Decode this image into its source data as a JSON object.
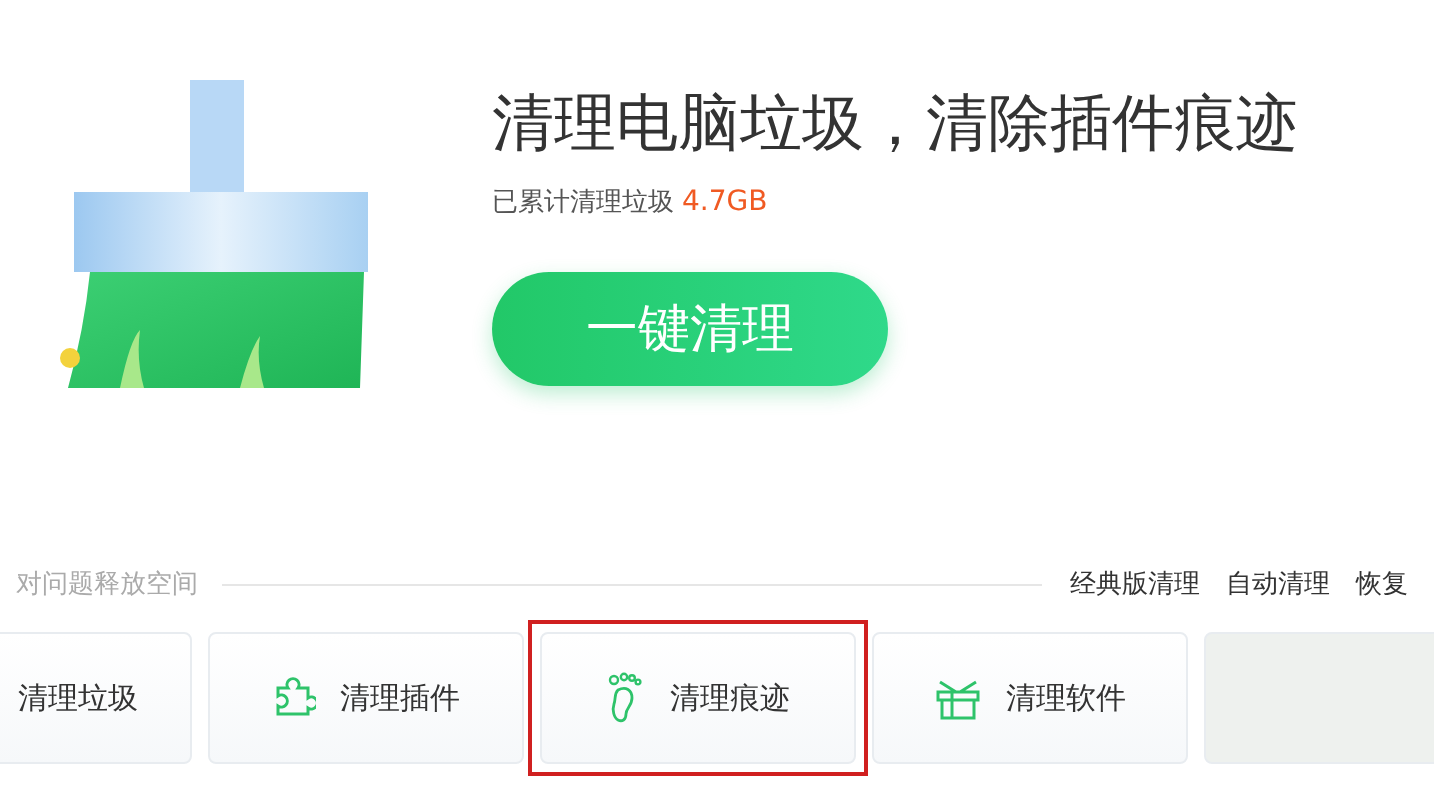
{
  "headline": "清理电脑垃圾，清除插件痕迹",
  "stats": {
    "label": "已累计清理垃圾",
    "value": "4.7GB"
  },
  "clean_button": "一键清理",
  "section": {
    "label": "对问题释放空间",
    "links": [
      "经典版清理",
      "自动清理",
      "恢复"
    ]
  },
  "cards": [
    {
      "kind": "trash",
      "label": "清理垃圾",
      "highlighted": false
    },
    {
      "kind": "plugin",
      "label": "清理插件",
      "highlighted": false
    },
    {
      "kind": "footprint",
      "label": "清理痕迹",
      "highlighted": true
    },
    {
      "kind": "software",
      "label": "清理软件",
      "highlighted": false
    },
    {
      "kind": "blurred",
      "highlighted": false
    }
  ]
}
